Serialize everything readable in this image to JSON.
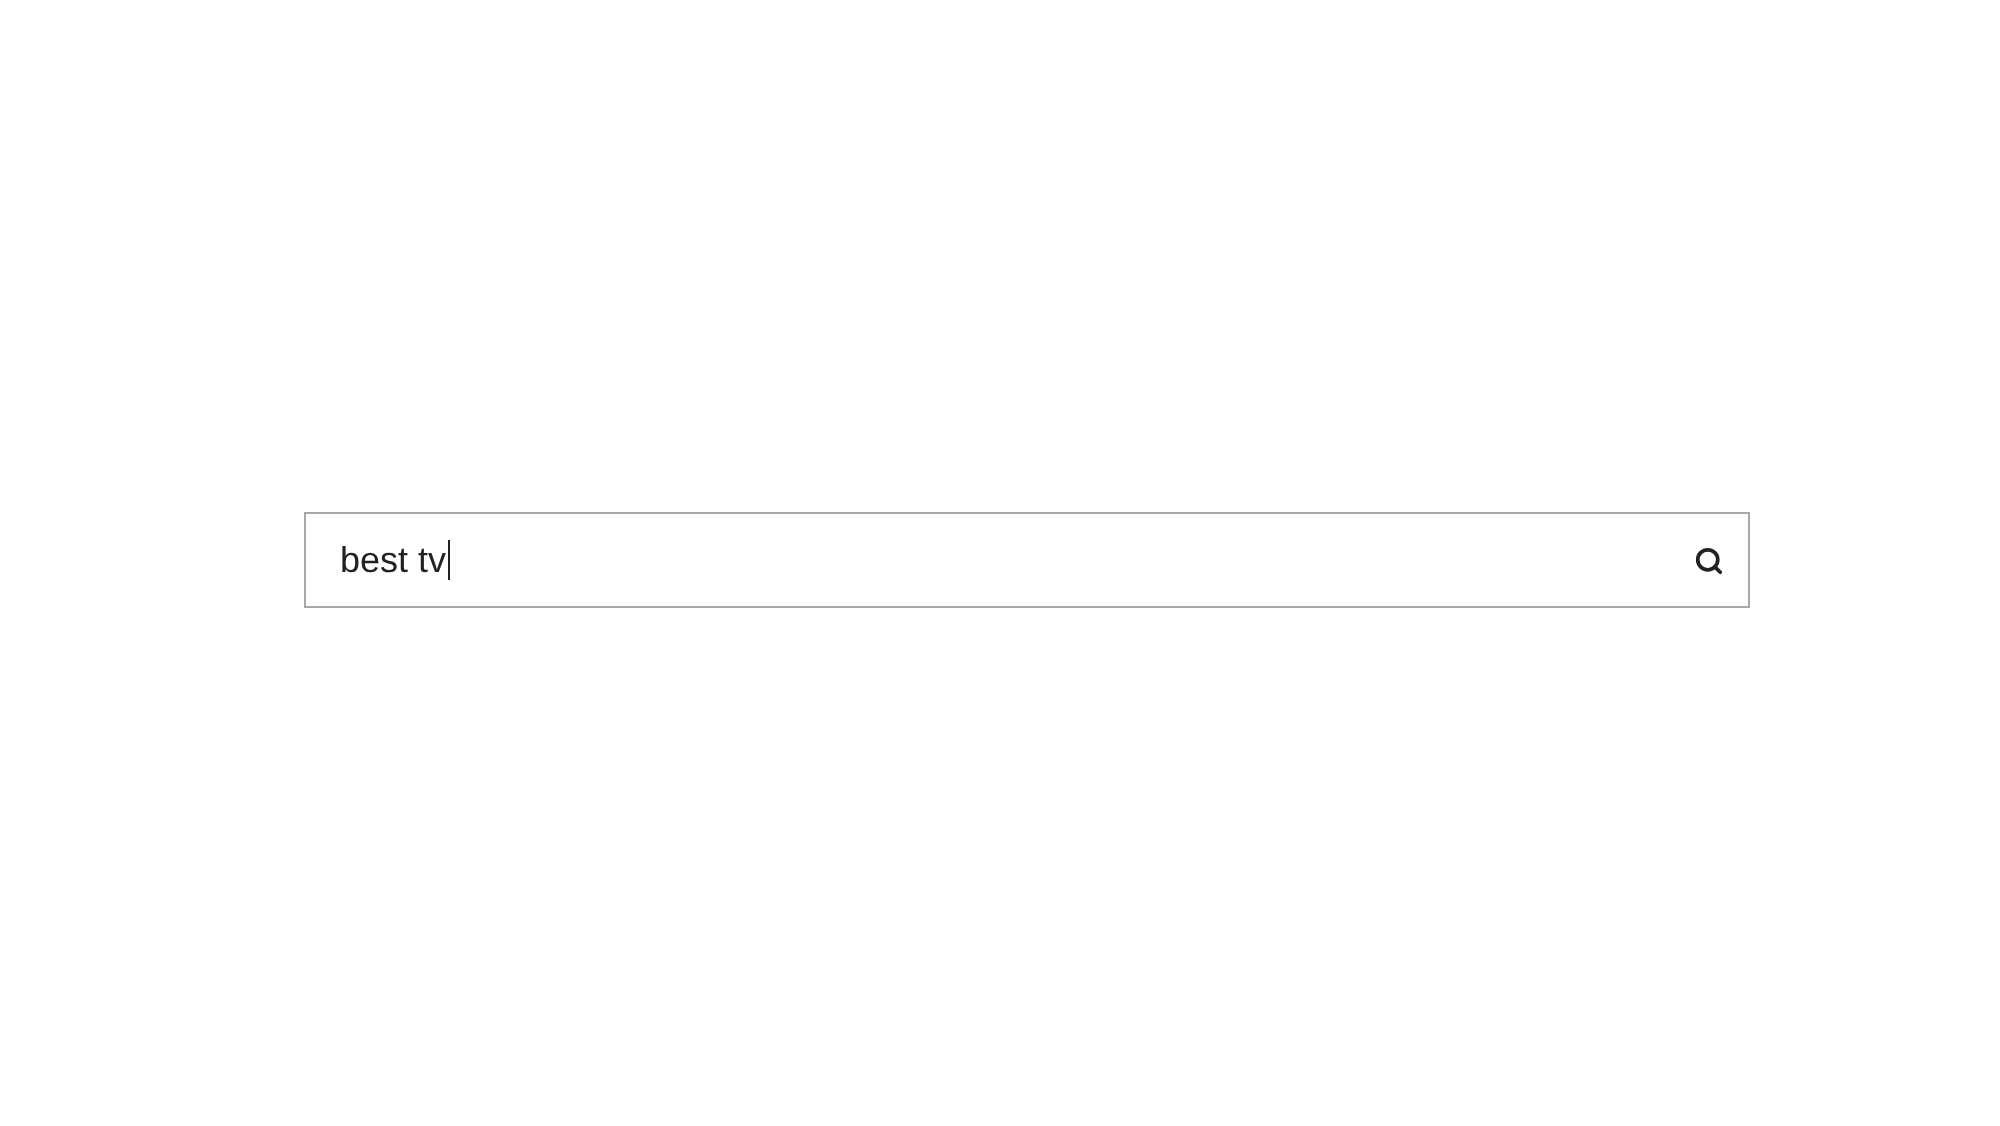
{
  "search": {
    "value": "best tv"
  }
}
